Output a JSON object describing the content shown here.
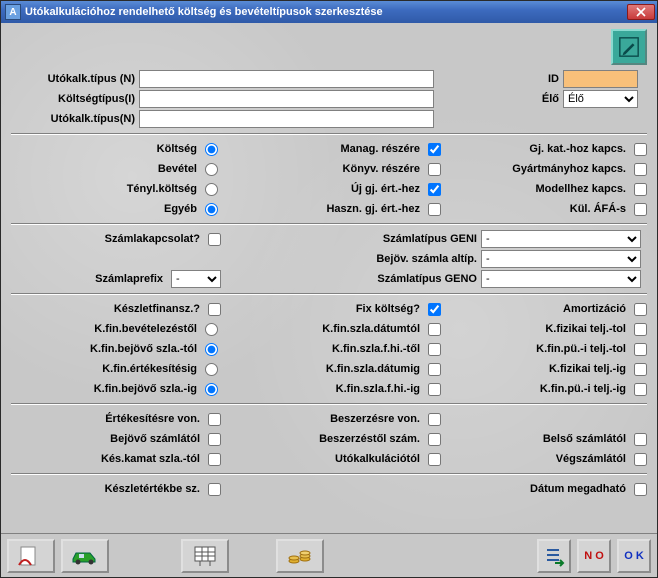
{
  "window": {
    "title": "Utókalkulációhoz rendelhető költség és bevételtípusok szerkesztése"
  },
  "top": {
    "utokalk_tipus_n_label": "Utókalk.típus (N)",
    "utokalk_tipus_n_value": "",
    "id_label": "ID",
    "id_value": "",
    "koltsegtipus_label": "Költségtípus(I)",
    "koltsegtipus_value": "",
    "elo_label": "Élő",
    "elo_value": "Élő",
    "utokalk_tipus_n2_label": "Utókalk.típus(N)",
    "utokalk_tipus_n2_value": ""
  },
  "radios": {
    "koltseg": "Költség",
    "bevetel": "Bevétel",
    "tenyl_koltseg": "Tényl.költség",
    "egyeb": "Egyéb"
  },
  "midcol": {
    "manag": "Manag. részére",
    "konyv": "Könyv. részére",
    "uj_gj": "Új gj. ért.-hez",
    "haszn_gj": "Haszn. gj. ért.-hez"
  },
  "rightcol": {
    "gj_kat": "Gj. kat.-hoz kapcs.",
    "gyart": "Gyártmányhoz kapcs.",
    "modell": "Modellhez kapcs.",
    "kul_afa": "Kül. ÁFÁ-s"
  },
  "sec2": {
    "szamlakapcs": "Számlakapcsolat?",
    "szamlatipus_geni": "Számlatípus GENI",
    "bejov_szamla_altip": "Bejöv. számla altíp.",
    "szamlaprefix": "Számlaprefix",
    "szamlaprefix_value": "-",
    "szamlatipus_geno": "Számlatípus GENO",
    "sel_geni": "-",
    "sel_altip": "-",
    "sel_geno": "-"
  },
  "sec3": {
    "keszletfin": "Készletfinansz.?",
    "fix_koltseg": "Fix költség?",
    "amort": "Amortizáció",
    "r1": {
      "c1": "K.fin.bevételezéstől",
      "c2": "K.fin.szla.dátumtól",
      "c3": "K.fizikai telj.-tol"
    },
    "r2": {
      "c1": "K.fin.bejövő szla.-tól",
      "c2": "K.fin.szla.f.hi.-től",
      "c3": "K.fin.pü.-i telj.-tol"
    },
    "r3": {
      "c1": "K.fin.értékesítésig",
      "c2": "K.fin.szla.dátumig",
      "c3": "K.fizikai telj.-ig"
    },
    "r4": {
      "c1": "K.fin.bejövő szla.-ig",
      "c2": "K.fin.szla.f.hi.-ig",
      "c3": "K.fin.pü.-i telj.-ig"
    }
  },
  "sec4": {
    "r1": {
      "c1": "Értékesítésre von.",
      "c2": "Beszerzésre von."
    },
    "r2": {
      "c1": "Bejövő számlától",
      "c2": "Beszerzéstől szám.",
      "c3": "Belső számlától"
    },
    "r3": {
      "c1": "Kés.kamat szla.-tól",
      "c2": "Utókalkulációtól",
      "c3": "Végszámlától"
    }
  },
  "sec5": {
    "c1": "Készletértékbe sz.",
    "c3": "Dátum megadható"
  },
  "buttons": {
    "no": "N O",
    "ok": "O K"
  }
}
